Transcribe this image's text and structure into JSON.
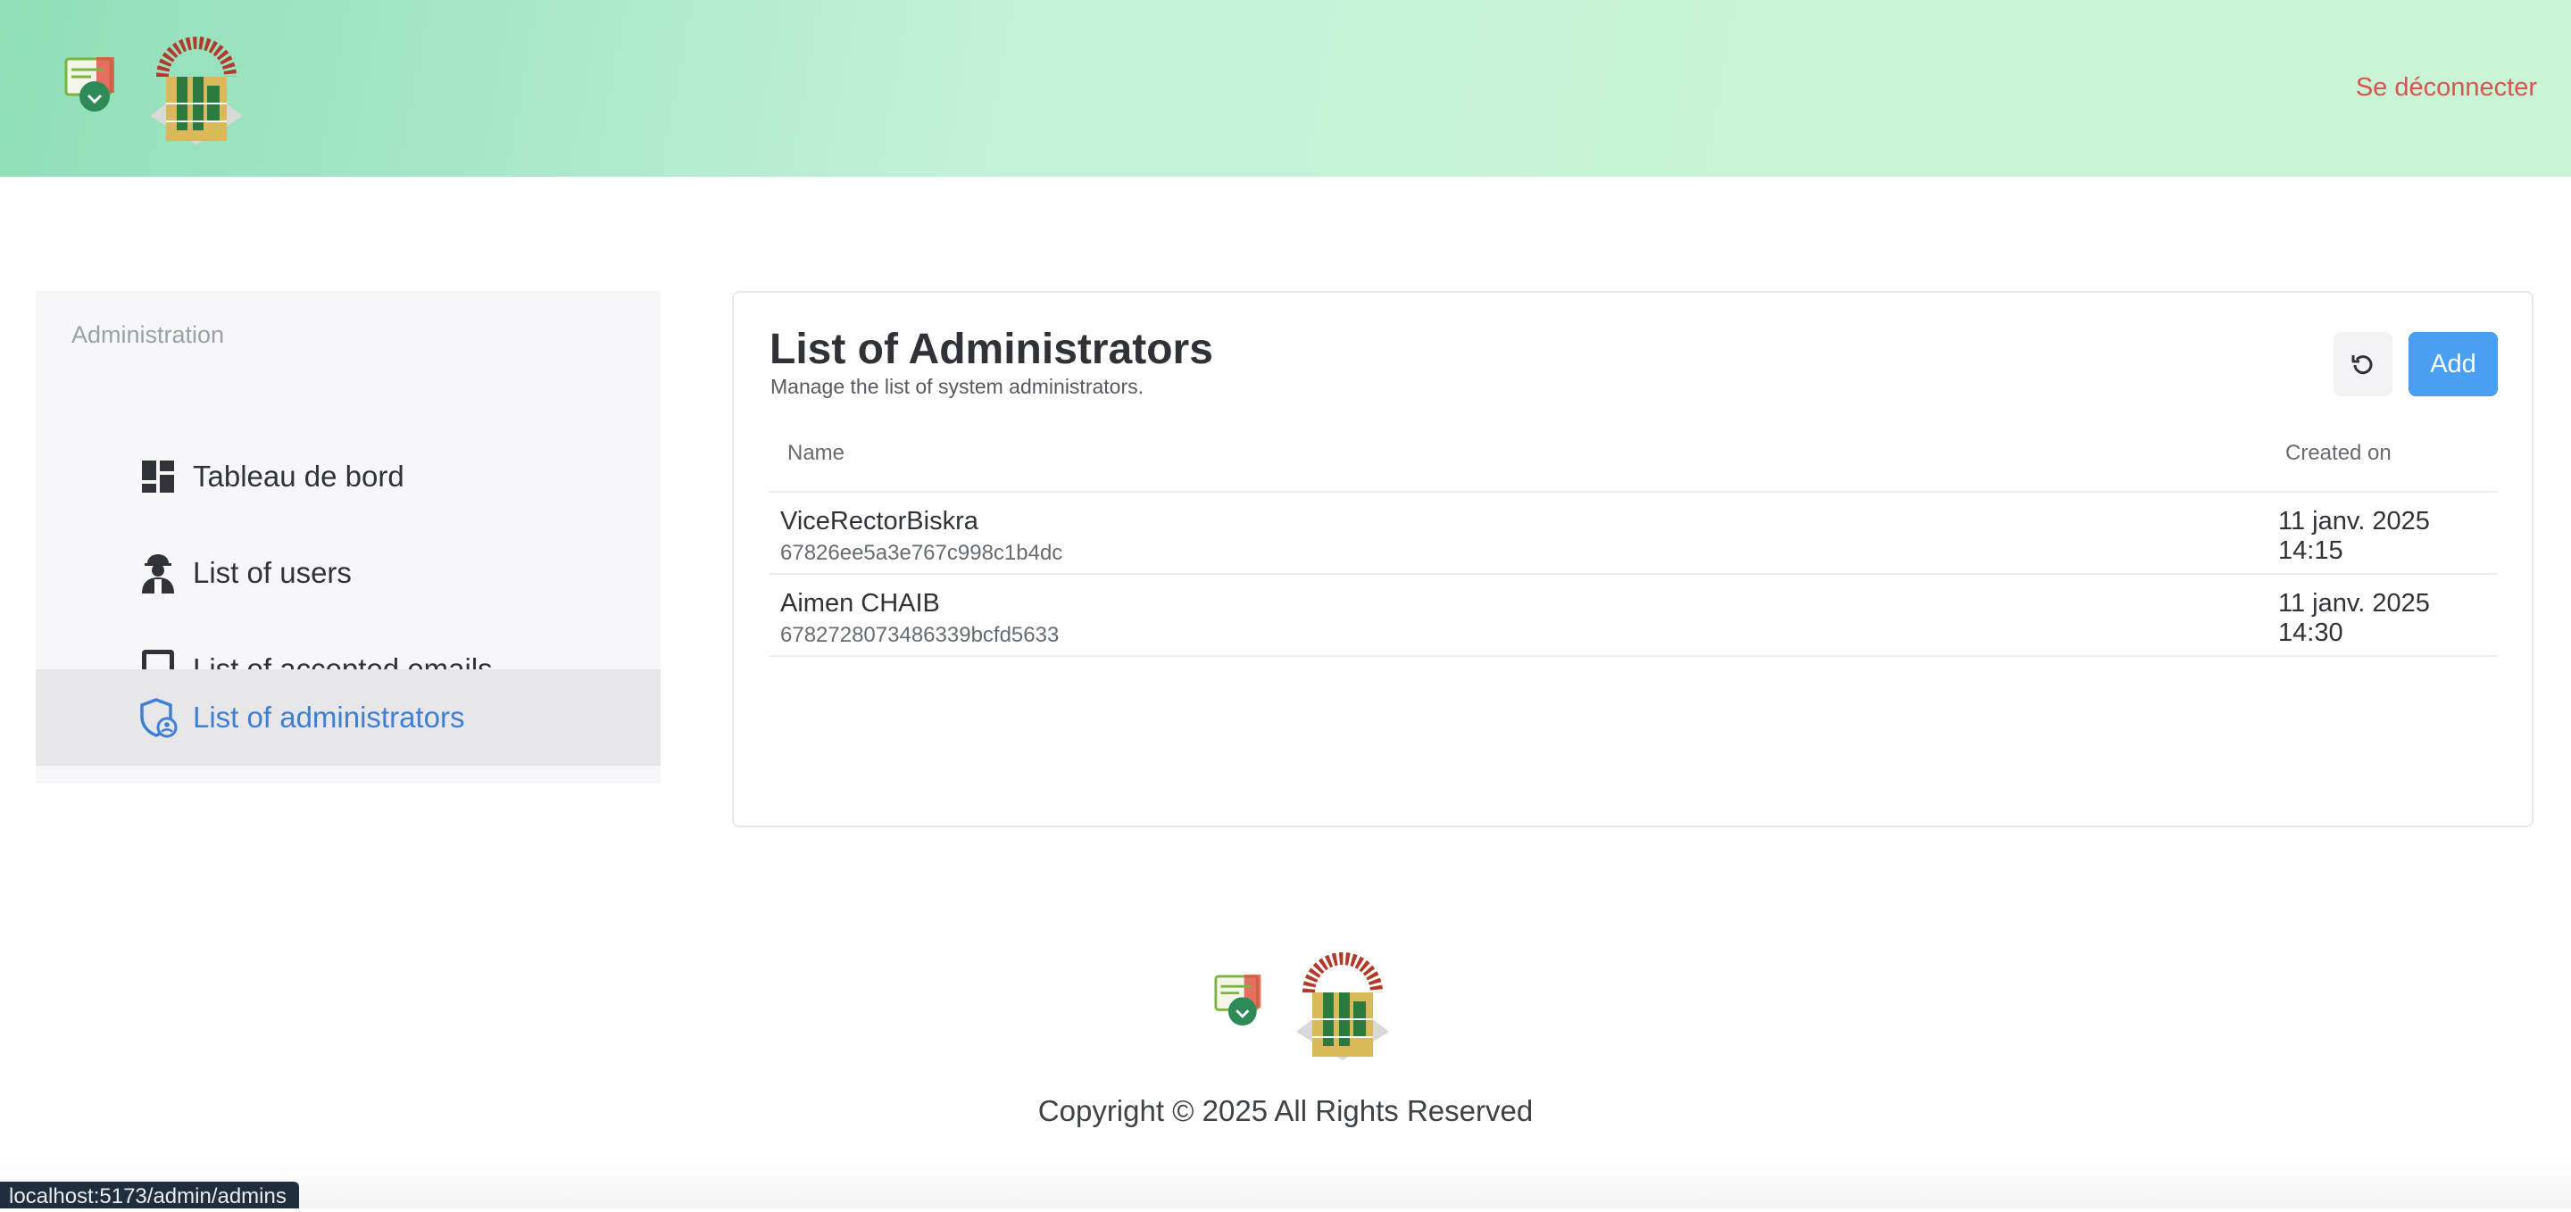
{
  "header": {
    "logout_label": "Se déconnecter"
  },
  "sidebar": {
    "section_title": "Administration",
    "items": [
      {
        "label": "Tableau de bord",
        "icon": "dashboard-icon",
        "active": false
      },
      {
        "label": "List of users",
        "icon": "user-worker-icon",
        "active": false
      },
      {
        "label": "List of accepted emails",
        "icon": "tablet-icon",
        "active": false
      },
      {
        "label": "List of administrators",
        "icon": "admin-shield-icon",
        "active": true
      }
    ]
  },
  "main": {
    "title": "List of Administrators",
    "subtitle": "Manage the list of system administrators.",
    "refresh_icon": "refresh-icon",
    "add_label": "Add",
    "table": {
      "columns": [
        "Name",
        "Created on"
      ],
      "rows": [
        {
          "name": "ViceRectorBiskra",
          "id": "67826ee5a3e767c998c1b4dc",
          "created": "11 janv. 2025 14:15"
        },
        {
          "name": "Aimen CHAIB",
          "id": "6782728073486339bcfd5633",
          "created": "11 janv. 2025 14:30"
        }
      ]
    }
  },
  "footer": {
    "copyright": "Copyright © 2025 All Rights Reserved"
  },
  "status_bar": {
    "url": "localhost:5173/admin/admins"
  },
  "colors": {
    "accent": "#4a9ff2",
    "active_link": "#3d7fd4",
    "logout": "#d9534f",
    "header_green": "#c9f4d5"
  }
}
